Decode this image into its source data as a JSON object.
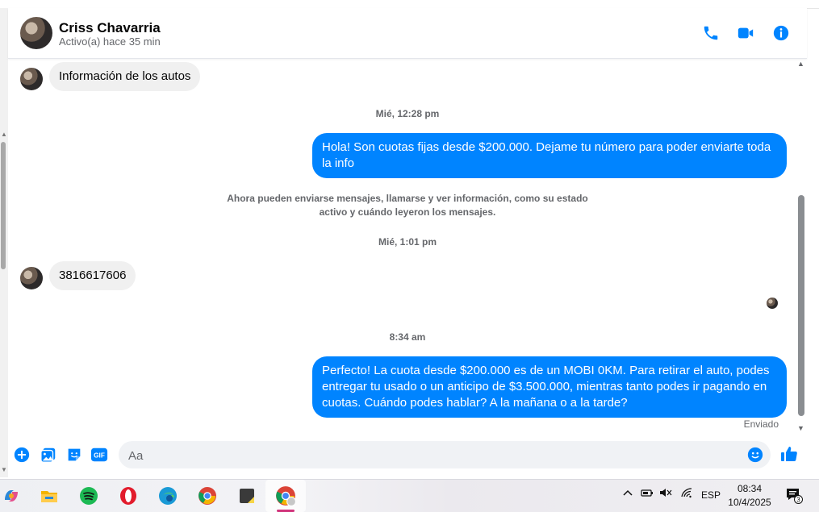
{
  "header": {
    "contact_name": "Criss Chavarria",
    "status": "Activo(a) hace 35 min",
    "call_icon": "phone-icon",
    "video_icon": "video-camera-icon",
    "info_icon": "info-icon",
    "accent": "#0084ff"
  },
  "messages": [
    {
      "type": "incoming",
      "text": "Información de los autos"
    },
    {
      "type": "timestamp",
      "text": "Mié, 12:28 pm"
    },
    {
      "type": "outgoing",
      "text": "Hola! Son cuotas fijas desde $200.000. Dejame tu número para poder enviarte toda la info"
    },
    {
      "type": "system",
      "text": "Ahora pueden enviarse mensajes, llamarse y ver información, como su estado activo y cuándo leyeron los mensajes."
    },
    {
      "type": "timestamp",
      "text": "Mié, 1:01 pm"
    },
    {
      "type": "incoming",
      "text": "3816617606"
    },
    {
      "type": "timestamp",
      "text": "8:34 am"
    },
    {
      "type": "outgoing",
      "text": "Perfecto! La cuota desde $200.000 es de un MOBI 0KM. Para retirar el auto, podes entregar tu usado o un anticipo de $3.500.000, mientras tanto podes ir pagando en cuotas. Cuándo podes hablar? A la mañana o a la tarde?"
    },
    {
      "type": "status",
      "text": "Enviado"
    }
  ],
  "composer": {
    "placeholder": "Aa",
    "icons": [
      "plus-icon",
      "photo-icon",
      "sticker-icon",
      "gif-icon"
    ],
    "gif_label": "GIF",
    "emoji_icon": "emoji-icon",
    "like_icon": "thumbs-up-icon"
  },
  "taskbar": {
    "apps": [
      "copilot-icon",
      "file-explorer-icon",
      "spotify-icon",
      "opera-icon",
      "edge-icon",
      "chrome-icon",
      "sticky-notes-icon",
      "chrome-profile-icon"
    ],
    "language": "ESP",
    "time": "08:34",
    "date": "10/4/2025",
    "notification_count": "3"
  }
}
